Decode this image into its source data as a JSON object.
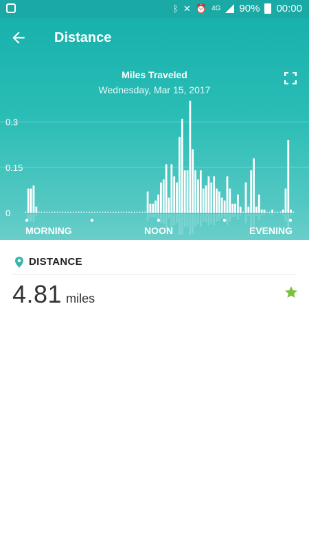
{
  "status_bar": {
    "battery": "90%",
    "time": "00:00",
    "network": "4G",
    "icons": [
      "bluetooth-icon",
      "mute-icon",
      "alarm-icon",
      "signal-icon",
      "battery-icon"
    ]
  },
  "header": {
    "title": "Distance",
    "back_icon": "arrow-left-icon",
    "expand_icon": "fullscreen-icon"
  },
  "chart_data": {
    "type": "bar",
    "title": "Miles Traveled",
    "subtitle": "Wednesday, Mar 15, 2017",
    "y_ticks": [
      "0.3",
      "0.15",
      "0"
    ],
    "ylim": [
      0,
      0.39
    ],
    "x_labels": [
      "MORNING",
      "NOON",
      "EVENING"
    ],
    "values": [
      0,
      0.08,
      0.08,
      0.09,
      0.02,
      0,
      0,
      0,
      0,
      0,
      0,
      0,
      0,
      0,
      0,
      0,
      0,
      0,
      0,
      0,
      0,
      0,
      0,
      0,
      0,
      0,
      0,
      0,
      0,
      0,
      0,
      0,
      0,
      0,
      0,
      0,
      0,
      0,
      0,
      0,
      0,
      0,
      0,
      0,
      0,
      0,
      0.07,
      0.03,
      0.03,
      0.04,
      0.06,
      0.1,
      0.11,
      0.16,
      0.05,
      0.16,
      0.12,
      0.1,
      0.25,
      0.31,
      0.14,
      0.14,
      0.37,
      0.21,
      0.14,
      0.11,
      0.14,
      0.08,
      0.09,
      0.12,
      0.1,
      0.12,
      0.08,
      0.07,
      0.05,
      0.04,
      0.12,
      0.08,
      0.03,
      0.03,
      0.06,
      0.02,
      0,
      0.1,
      0.02,
      0.14,
      0.18,
      0.02,
      0.06,
      0.01,
      0.01,
      0,
      0,
      0.01,
      0,
      0,
      0,
      0.01,
      0.08,
      0.24,
      0.01,
      0
    ]
  },
  "distance": {
    "label": "DISTANCE",
    "value": "4.81",
    "unit": "miles",
    "pin_icon": "location-pin-icon",
    "goal_icon": "star-icon",
    "goal_color": "#7ac142"
  },
  "colors": {
    "accent": "#1aa9a5"
  }
}
